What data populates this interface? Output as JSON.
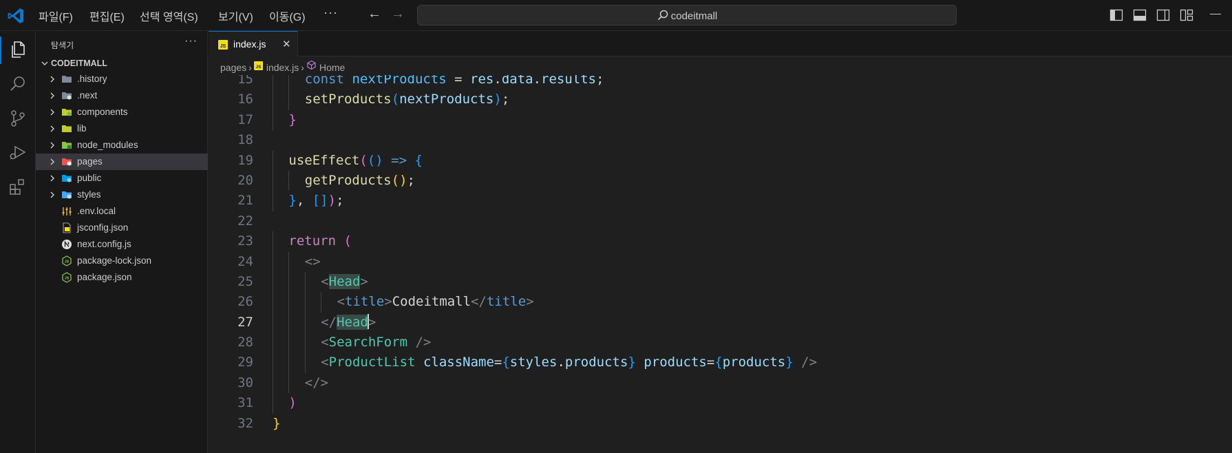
{
  "menu": {
    "items": [
      "파일(F)",
      "편집(E)",
      "선택 영역(S)",
      "보기(V)",
      "이동(G)"
    ],
    "more": "···"
  },
  "command_center": {
    "text": "codeitmall"
  },
  "explorer": {
    "title": "탐색기",
    "more": "···",
    "folder": "CODEITMALL",
    "items": [
      {
        "label": ".history",
        "icon": "folder-gray-icon",
        "expandable": true,
        "selected": false
      },
      {
        "label": ".next",
        "icon": "folder-next-icon",
        "expandable": true,
        "selected": false
      },
      {
        "label": "components",
        "icon": "folder-components-icon",
        "expandable": true,
        "selected": false
      },
      {
        "label": "lib",
        "icon": "folder-lib-icon",
        "expandable": true,
        "selected": false
      },
      {
        "label": "node_modules",
        "icon": "folder-node-icon",
        "expandable": true,
        "selected": false
      },
      {
        "label": "pages",
        "icon": "folder-pages-icon",
        "expandable": true,
        "selected": true
      },
      {
        "label": "public",
        "icon": "folder-public-icon",
        "expandable": true,
        "selected": false
      },
      {
        "label": "styles",
        "icon": "folder-styles-icon",
        "expandable": true,
        "selected": false
      },
      {
        "label": ".env.local",
        "icon": "env-settings-icon",
        "expandable": false,
        "selected": false
      },
      {
        "label": "jsconfig.json",
        "icon": "jsconfig-icon",
        "expandable": false,
        "selected": false
      },
      {
        "label": "next.config.js",
        "icon": "nextjs-icon",
        "expandable": false,
        "selected": false
      },
      {
        "label": "package-lock.json",
        "icon": "nodejs-icon",
        "expandable": false,
        "selected": false
      },
      {
        "label": "package.json",
        "icon": "nodejs-icon",
        "expandable": false,
        "selected": false
      }
    ]
  },
  "tab": {
    "label": "index.js",
    "close": "✕"
  },
  "breadcrumb": {
    "items": [
      "pages",
      "index.js",
      "Home"
    ]
  },
  "editor": {
    "active_line": 27,
    "lines": [
      {
        "n": 15,
        "i": 2,
        "t": [
          [
            "kw",
            "const "
          ],
          [
            "const",
            "nextProducts"
          ],
          [
            "txt",
            " = "
          ],
          [
            "var",
            "res"
          ],
          [
            "txt",
            "."
          ],
          [
            "var",
            "data"
          ],
          [
            "txt",
            "."
          ],
          [
            "var",
            "results"
          ],
          [
            "txt",
            ";"
          ]
        ]
      },
      {
        "n": 16,
        "i": 2,
        "t": [
          [
            "fn",
            "setProducts"
          ],
          [
            "b3",
            "("
          ],
          [
            "var",
            "nextProducts"
          ],
          [
            "b3",
            ")"
          ],
          [
            "txt",
            ";"
          ]
        ]
      },
      {
        "n": 17,
        "i": 1,
        "t": [
          [
            "b2",
            "}"
          ]
        ]
      },
      {
        "n": 18,
        "i": 1,
        "t": []
      },
      {
        "n": 19,
        "i": 1,
        "t": [
          [
            "fn",
            "useEffect"
          ],
          [
            "b2",
            "("
          ],
          [
            "b3",
            "() "
          ],
          [
            "kw",
            "=>"
          ],
          [
            "txt",
            " "
          ],
          [
            "b3",
            "{"
          ]
        ]
      },
      {
        "n": 20,
        "i": 2,
        "t": [
          [
            "fn",
            "getProducts"
          ],
          [
            "b1",
            "()"
          ],
          [
            "txt",
            ";"
          ]
        ]
      },
      {
        "n": 21,
        "i": 1,
        "t": [
          [
            "b3",
            "}"
          ],
          [
            "txt",
            ", "
          ],
          [
            "b3",
            "[]"
          ],
          [
            "b2",
            ")"
          ],
          [
            "txt",
            ";"
          ]
        ]
      },
      {
        "n": 22,
        "i": 1,
        "t": []
      },
      {
        "n": 23,
        "i": 1,
        "t": [
          [
            "ctl",
            "return "
          ],
          [
            "b2",
            "("
          ]
        ]
      },
      {
        "n": 24,
        "i": 2,
        "t": [
          [
            "tagb",
            "<>"
          ]
        ]
      },
      {
        "n": 25,
        "i": 3,
        "t": [
          [
            "tagb",
            "<"
          ],
          [
            "tag hl",
            "Head"
          ],
          [
            "tagb",
            ">"
          ]
        ]
      },
      {
        "n": 26,
        "i": 4,
        "t": [
          [
            "tagb",
            "<"
          ],
          [
            "htag",
            "title"
          ],
          [
            "tagb",
            ">"
          ],
          [
            "txt",
            "Codeitmall"
          ],
          [
            "tagb",
            "</"
          ],
          [
            "htag",
            "title"
          ],
          [
            "tagb",
            ">"
          ]
        ]
      },
      {
        "n": 27,
        "i": 3,
        "t": [
          [
            "tagb",
            "</"
          ],
          [
            "tag hl",
            "Head"
          ],
          [
            "cursor",
            ""
          ],
          [
            "tagb",
            ">"
          ]
        ]
      },
      {
        "n": 28,
        "i": 3,
        "t": [
          [
            "tagb",
            "<"
          ],
          [
            "tag",
            "SearchForm"
          ],
          [
            "tagb",
            " />"
          ]
        ]
      },
      {
        "n": 29,
        "i": 3,
        "t": [
          [
            "tagb",
            "<"
          ],
          [
            "tag",
            "ProductList"
          ],
          [
            "txt",
            " "
          ],
          [
            "attr",
            "className"
          ],
          [
            "txt",
            "="
          ],
          [
            "b3",
            "{"
          ],
          [
            "var",
            "styles"
          ],
          [
            "txt",
            "."
          ],
          [
            "var",
            "products"
          ],
          [
            "b3",
            "}"
          ],
          [
            "txt",
            " "
          ],
          [
            "attr",
            "products"
          ],
          [
            "txt",
            "="
          ],
          [
            "b3",
            "{"
          ],
          [
            "var",
            "products"
          ],
          [
            "b3",
            "}"
          ],
          [
            "tagb",
            " />"
          ]
        ]
      },
      {
        "n": 30,
        "i": 2,
        "t": [
          [
            "tagb",
            "</>"
          ]
        ]
      },
      {
        "n": 31,
        "i": 1,
        "t": [
          [
            "b2",
            ")"
          ]
        ]
      },
      {
        "n": 32,
        "i": 0,
        "t": [
          [
            "b1",
            "}"
          ]
        ]
      }
    ]
  }
}
